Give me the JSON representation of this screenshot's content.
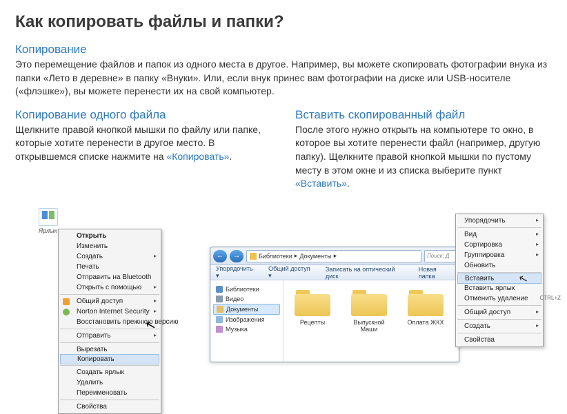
{
  "page": {
    "title": "Как копировать файлы и папки?"
  },
  "intro": {
    "heading": "Копирование",
    "text": "Это перемещение файлов и папок из одного места в другое. Например, вы можете скопировать фотографии внука из папки «Лето в деревне» в папку «Внуки». Или, если внук принес вам фото­графии на диске или USB-носителе («флэшке»), вы можете перенести их на свой компьютер."
  },
  "left": {
    "heading": "Копирование одного файла",
    "text_pre": "Щелкните правой кнопкой мышки по файлу или папке, которые хотите пере­нести в другое место. В открывшемся списке нажмите на ",
    "link": "«Копировать»",
    "text_post": "."
  },
  "right": {
    "heading": "Вставить скопированный файл",
    "text_pre": "После этого нужно открыть на компьютере то окно, в которое вы хотите перенести файл (например, дру­гую папку). Щелкните правой кнопкой мышки по пу­стому месту в этом окне и из списка выберите пункт ",
    "link": "«Вставить»",
    "text_post": "."
  },
  "desktop_caption": "Ярлык",
  "ctx1": {
    "open": "Открыть",
    "edit": "Изменить",
    "create": "Создать",
    "print": "Печать",
    "bt": "Отправить на Bluetooth",
    "openwith": "Открыть с помощью",
    "share": "Общий доступ",
    "norton": "Norton Internet Security",
    "restore": "Восстановить прежнюю версию",
    "send": "Отправить",
    "cut": "Вырезать",
    "copy": "Копировать",
    "shortcut": "Создать ярлык",
    "delete": "Удалить",
    "rename": "Переименовать",
    "props": "Свойства"
  },
  "explorer": {
    "breadcrumb_a": "Библиотеки",
    "breadcrumb_b": "Документы",
    "search_ph": "Поиск: Д",
    "tb_organize": "Упорядочить ▾",
    "tb_share": "Общий доступ ▾",
    "tb_burn": "Записать на оптический диск",
    "tb_new": "Новая папка",
    "side_lib": "Библиотеки",
    "side_video": "Видео",
    "side_docs": "Документы",
    "side_img": "Изображения",
    "side_music": "Музыка",
    "folder1": "Рецепты",
    "folder2": "Выпускной Маши",
    "folder3": "Оплата ЖКХ"
  },
  "ctx2": {
    "arrange": "Упорядочить",
    "view": "Вид",
    "sort": "Сортировка",
    "group": "Группировка",
    "refresh": "Обновить",
    "paste": "Вставить",
    "paste_shortcut": "Вставить ярлык",
    "undo": "Отменить удаление",
    "undo_kb": "CTRL+Z",
    "share": "Общий доступ",
    "create": "Создать",
    "props": "Свойства"
  }
}
